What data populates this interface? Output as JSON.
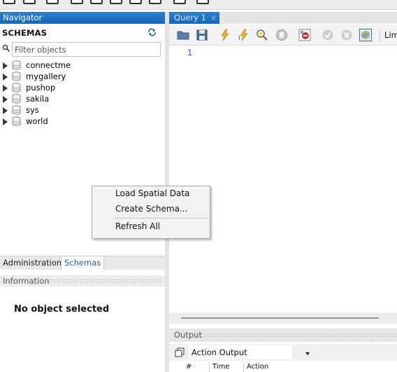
{
  "navigator": {
    "title": "Navigator",
    "schemas_title": "SCHEMAS",
    "filter_placeholder": "Filter objects",
    "schemas": [
      "connectme",
      "mygallery",
      "pushop",
      "sakila",
      "sys",
      "world"
    ]
  },
  "bottom_tabs": {
    "administration": "Administration",
    "schemas": "Schemas",
    "active": "Schemas"
  },
  "information": {
    "header": "Information",
    "empty_text": "No object selected"
  },
  "context_menu": {
    "items": [
      "Load Spatial Data",
      "Create Schema...",
      "Refresh All"
    ]
  },
  "query": {
    "tab_label": "Query 1",
    "tab_close": "×",
    "limit_label": "Limi",
    "line_number": "1"
  },
  "output": {
    "header": "Output",
    "selector_value": "Action Output",
    "columns": [
      "#",
      "Time",
      "Action"
    ]
  },
  "colors": {
    "header_blue": "#1f73c5",
    "accent_blue": "#1a5fb4",
    "line_number_blue": "#2355c7"
  }
}
